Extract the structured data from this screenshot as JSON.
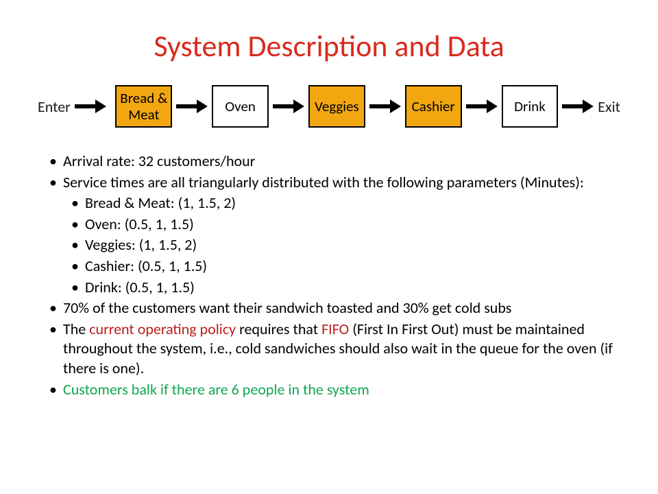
{
  "title": "System Description and Data",
  "flow": {
    "enter": "Enter",
    "exit": "Exit",
    "boxes": {
      "bread": "Bread & Meat",
      "oven": "Oven",
      "veggies": "Veggies",
      "cashier": "Cashier",
      "drink": "Drink"
    }
  },
  "bullets": {
    "arrival": "Arrival rate: 32 customers/hour",
    "service_intro": "Service times are all triangularly distributed with the following parameters (Minutes):",
    "service": {
      "bread": "Bread & Meat: (1, 1.5, 2)",
      "oven": "Oven: (0.5, 1, 1.5)",
      "veggies": "Veggies: (1, 1.5, 2)",
      "cashier": "Cashier: (0.5, 1, 1.5)",
      "drink": "Drink: (0.5, 1, 1.5)"
    },
    "toast": "70% of the customers want their sandwich toasted and 30% get cold subs",
    "policy_pre": "The ",
    "policy_red1": "current operating policy ",
    "policy_mid": "requires that ",
    "policy_red2": "FIFO ",
    "policy_post": "(First In First Out) must be maintained throughout the system, i.e., cold sandwiches should also wait in the queue for the oven (if there is one).",
    "balk": "Customers balk if there are 6 people in the system"
  }
}
